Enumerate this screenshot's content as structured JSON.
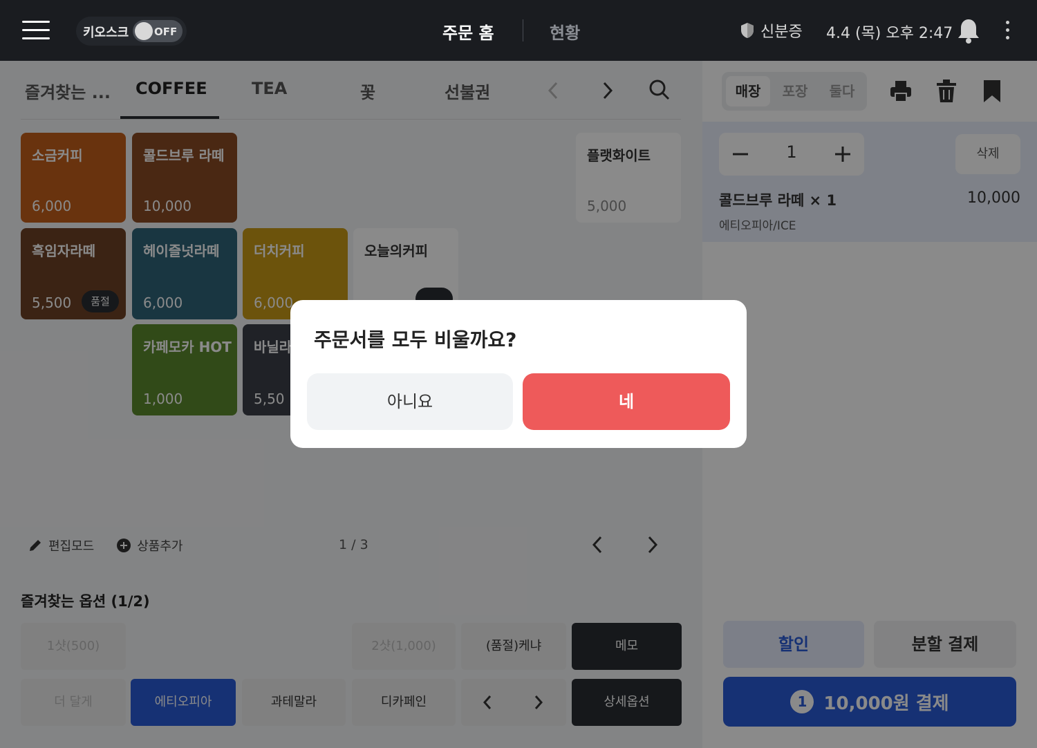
{
  "topbar": {
    "kiosk_label": "키오스크",
    "kiosk_toggle": "OFF",
    "nav_home": "주문 홈",
    "nav_status": "현황",
    "id_card": "신분증",
    "datetime": "4.4 (목) 오후 2:47"
  },
  "tabs": [
    "즐겨찾는 ...",
    "COFFEE",
    "TEA",
    "꽃",
    "선불권"
  ],
  "active_tab": "COFFEE",
  "products": [
    {
      "name": "소금커피",
      "price": "6,000",
      "color": "#c25e1b"
    },
    {
      "name": "콜드브루 라떼",
      "price": "10,000",
      "color": "#8a4a24"
    },
    {
      "name": "플랫화이트",
      "price": "5,000",
      "color": "#ffffff"
    },
    {
      "name": "흑임자라떼",
      "price": "5,500",
      "badge": "품절",
      "color": "#6e4226"
    },
    {
      "name": "헤이즐넛라떼",
      "price": "6,000",
      "color": "#2f6479"
    },
    {
      "name": "더치커피",
      "price": "6,000",
      "color": "#c79a17"
    },
    {
      "name": "오늘의커피",
      "price": "",
      "color": "#ffffff"
    },
    {
      "name": "카페모카 HOT",
      "price": "1,000",
      "color": "#5c8a2d"
    },
    {
      "name": "바닐라",
      "price": "5,50",
      "color": "#3c4048"
    }
  ],
  "toolbar": {
    "edit_mode": "편집모드",
    "add_product": "상품추가",
    "pager": "1 / 3"
  },
  "options": {
    "title": "즐겨찾는 옵션 (1/2)",
    "row1": [
      "1샷(500)",
      "2샷(1,000)",
      "(품절)케냐",
      "메모"
    ],
    "row2": [
      "더 달게",
      "에티오피아",
      "과테말라",
      "디카페인",
      "상세옵션"
    ]
  },
  "right": {
    "seg": [
      "매장",
      "포장",
      "둘다"
    ],
    "qty": "1",
    "delete": "삭제",
    "item_name": "콜드브루 라떼 × 1",
    "item_price": "10,000",
    "item_options": "에티오피아/ICE",
    "discount": "할인",
    "split_pay": "분할 결제",
    "pay_count": "1",
    "pay_label": "10,000원 결제"
  },
  "dialog": {
    "title": "주문서를 모두 비울까요?",
    "no": "아니요",
    "yes": "네"
  },
  "colors": {
    "accent_blue": "#2a5bd7",
    "danger_red": "#ee5a5a",
    "topbar": "#1a1c20"
  }
}
